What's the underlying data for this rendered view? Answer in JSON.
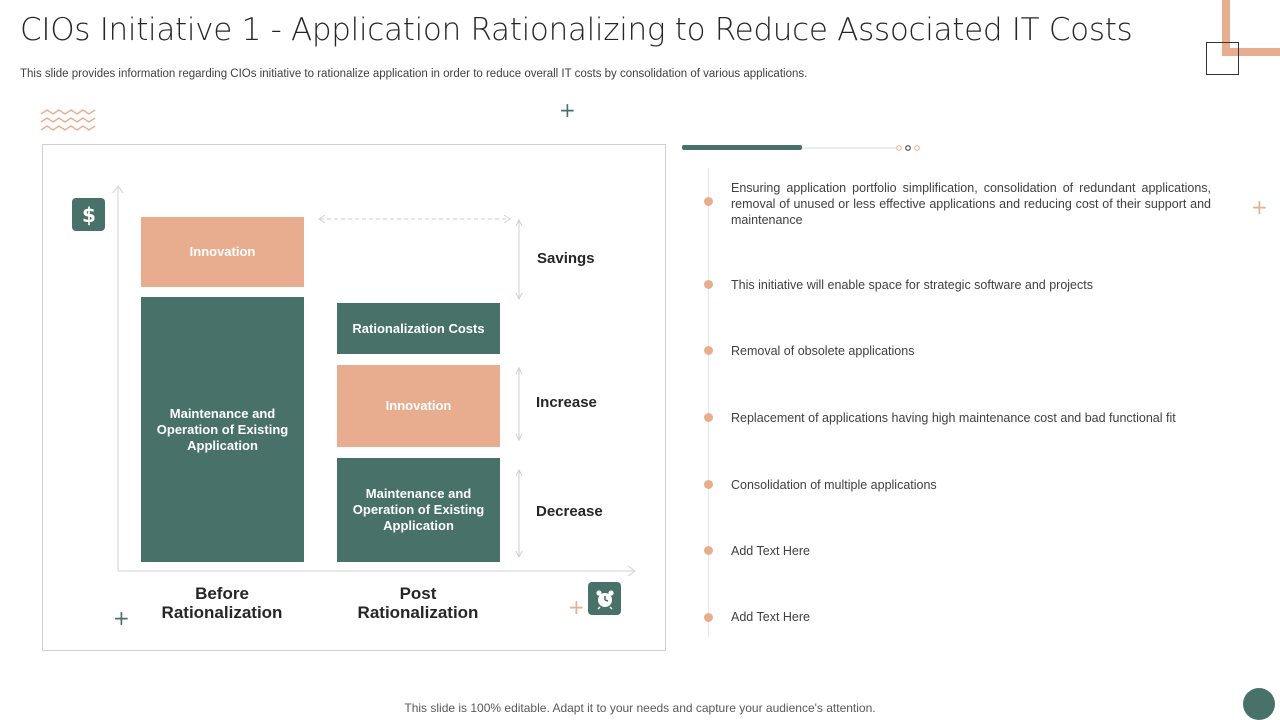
{
  "header": {
    "title": "CIOs Initiative 1 - Application Rationalizing to Reduce Associated IT Costs",
    "subtitle": "This slide provides information regarding CIOs initiative to rationalize application in order to reduce overall IT costs by consolidation of various applications."
  },
  "chart": {
    "before": {
      "innovation": "Innovation",
      "maintenance": "Maintenance and Operation of Existing Application"
    },
    "post": {
      "rationalization_costs": "Rationalization Costs",
      "innovation": "Innovation",
      "maintenance": "Maintenance and Operation of Existing Application"
    },
    "labels": {
      "savings": "Savings",
      "increase": "Increase",
      "decrease": "Decrease"
    },
    "x_labels": {
      "before": "Before Rationalization",
      "post": "Post Rationalization"
    },
    "icons": {
      "top_left": "dollar-icon",
      "bottom_right": "alarm-clock-icon"
    }
  },
  "bullets": [
    "Ensuring application portfolio simplification, consolidation of redundant applications, removal of unused or less effective applications and reducing cost of their support and maintenance",
    "This initiative will enable space for strategic software and projects",
    "Removal of obsolete applications",
    "Replacement of applications having high maintenance cost and bad functional fit",
    "Consolidation of multiple applications",
    "Add Text Here",
    "Add Text Here"
  ],
  "footer": {
    "text": "This slide is 100% editable. Adapt it to your needs and capture your audience's attention."
  },
  "colors": {
    "green": "#477169",
    "peach": "#e8ad8e",
    "text": "#404040"
  }
}
